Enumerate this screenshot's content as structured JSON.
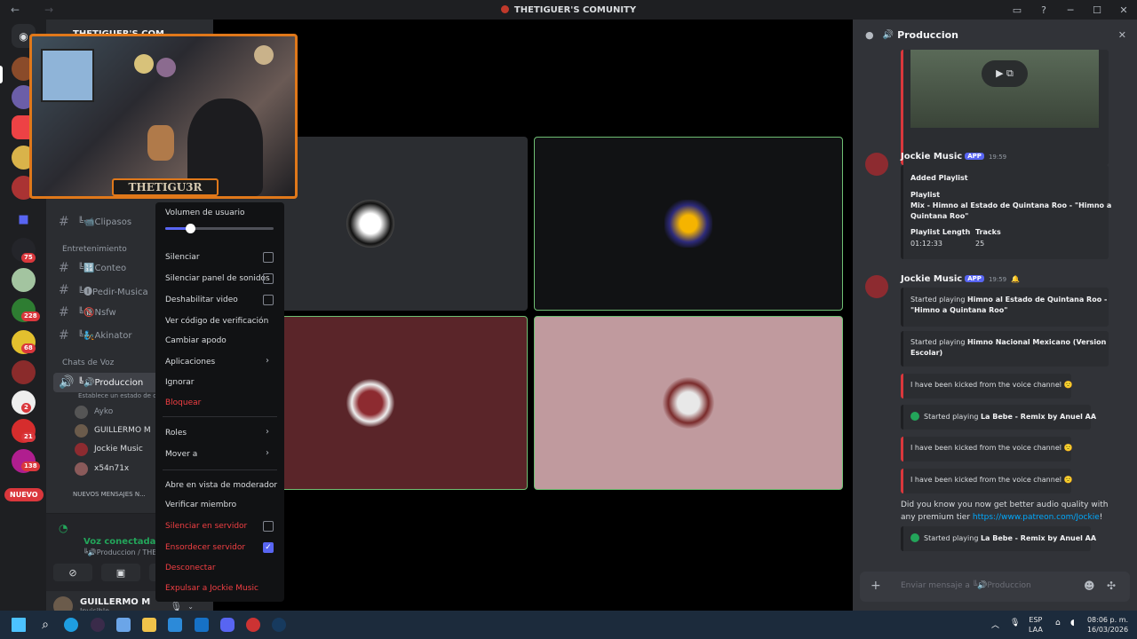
{
  "window": {
    "title": "THETIGUER'S COMUNITY"
  },
  "rail": {
    "badges": [
      "75",
      "228",
      "68",
      "2",
      "21",
      "138"
    ],
    "nuevo": "NUEVO"
  },
  "channels": {
    "server_name": "THETIGUER'S COM...",
    "items": [
      {
        "label": "╚📹Clipasos"
      },
      {
        "label": "Entretenimiento"
      },
      {
        "label": "╚🔢Conteo"
      },
      {
        "label": "╚🅘Pedir-Musica"
      },
      {
        "label": "╚🔞Nsfw"
      },
      {
        "label": "╚🧞Akinator"
      },
      {
        "label": "Chats de Voz"
      },
      {
        "label": "╚🔊Produccion"
      }
    ],
    "voice_status": "Establece un estado de c...",
    "voice_users": [
      "Ayko",
      "GUILLERMO M",
      "Jockie Music",
      "x54n71x"
    ],
    "new_messages": "NUEVOS MENSAJES N...",
    "voice_connected": "Voz conectada",
    "voice_sub": "╚🔊Produccion / THETIGUER'S CO...",
    "user_name": "GUILLERMO M",
    "user_status": "Invisible"
  },
  "webcam": {
    "label": "THETIGU3R"
  },
  "menu": {
    "volume_label": "Volumen de usuario",
    "volume_level": 0.23,
    "items": {
      "silenciar": "Silenciar",
      "silenciar_panel": "Silenciar panel de sonidos",
      "deshabilitar_video": "Deshabilitar video",
      "ver_codigo": "Ver código de verificación",
      "cambiar_apodo": "Cambiar apodo",
      "aplicaciones": "Aplicaciones",
      "ignorar": "Ignorar",
      "bloquear": "Bloquear",
      "roles": "Roles",
      "mover_a": "Mover a",
      "vista_moderador": "Abre en vista de moderador",
      "verificar_miembro": "Verificar miembro",
      "silenciar_servidor": "Silenciar en servidor",
      "ensordecer_servidor": "Ensordecer servidor",
      "desconectar": "Desconectar",
      "expulsar": "Expulsar a Jockie Music"
    }
  },
  "chat": {
    "channel": "Produccion",
    "msg1": {
      "author": "Jockie Music",
      "tag": "APP",
      "time": "19:59",
      "title": "Added Playlist",
      "playlist_label": "Playlist",
      "playlist_value_1": "Mix - Himno al Estado de Quintana Roo - \"Himno a",
      "playlist_value_2": "Quintana Roo\"",
      "length_label": "Playlist Length",
      "length_value": "01:12:33",
      "tracks_label": "Tracks",
      "tracks_value": "25"
    },
    "msg2": {
      "author": "Jockie Music",
      "tag": "APP",
      "time": "19:59"
    },
    "embeds": {
      "e1_prefix": "Started playing ",
      "e1_song_1": "Himno al Estado de Quintana Roo -",
      "e1_song_2": "\"Himno a Quintana Roo\"",
      "e2_prefix": "Started playing ",
      "e2_song_1": "Himno Nacional Mexicano (Version",
      "e2_song_2": "Escolar)",
      "kick1": "I have been kicked from the voice channel 🙁",
      "p1_prefix": "Started playing ",
      "p1_song": "La Bebe - Remix by Anuel AA",
      "kick2": "I have been kicked from the voice channel 🙁",
      "kick3": "I have been kicked from the voice channel 🙁",
      "premium_1": "Did you know you now get better audio quality with",
      "premium_2": "any premium tier ",
      "premium_link": "https://www.patreon.com/Jockie",
      "premium_end": "!",
      "p2_prefix": "Started playing ",
      "p2_song": "La Bebe - Remix by Anuel AA"
    },
    "composer_placeholder": "Enviar mensaje a ╚🔊Produccion"
  },
  "taskbar": {
    "lang_1": "ESP",
    "lang_2": "LAA",
    "time": "08:06 p. m.",
    "date": "16/03/2026"
  }
}
